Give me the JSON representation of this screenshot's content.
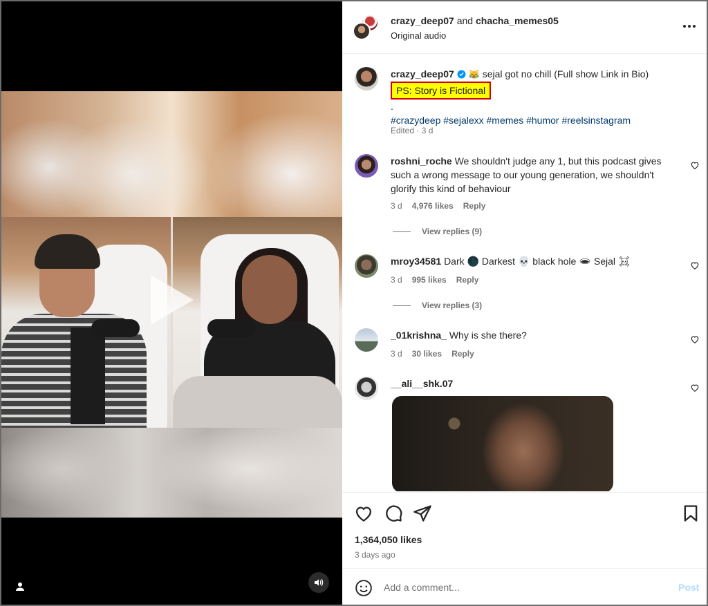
{
  "header": {
    "user1": "crazy_deep07",
    "joiner": "and",
    "user2": "chacha_memes05",
    "audio": "Original audio"
  },
  "caption": {
    "username": "crazy_deep07",
    "text": "sejal got no chill (Full show Link in Bio)",
    "highlighted": "PS: Story is Fictional",
    "dot": ".",
    "hashtags": "#crazydeep #sejalexx #memes #humor #reelsinstagram",
    "edited": "Edited · 3 d"
  },
  "comments": [
    {
      "username": "roshni_roche",
      "text": "We shouldn't judge any 1, but this podcast gives such a wrong message to our young generation, we shouldn't glorify this kind of behaviour",
      "age": "3 d",
      "likes": "4,976 likes",
      "reply": "Reply",
      "view_replies": "View replies (9)"
    },
    {
      "username": "mroy34581",
      "text": "Dark 🌑 Darkest 💀 black hole 🕳 Sejal ☠",
      "age": "3 d",
      "likes": "995 likes",
      "reply": "Reply",
      "view_replies": "View replies (3)"
    },
    {
      "username": "_01krishna_",
      "text": "Why is she there?",
      "age": "3 d",
      "likes": "30 likes",
      "reply": "Reply"
    },
    {
      "username": "__ali__shk.07"
    }
  ],
  "engagement": {
    "likes": "1,364,050 likes",
    "posted": "3 days ago"
  },
  "composer": {
    "placeholder": "Add a comment...",
    "post_label": "Post"
  },
  "colors": {
    "verified": "#0095f6",
    "highlight_bg": "#ffff00",
    "highlight_border": "#d40000",
    "hashtag": "#00376b",
    "post_disabled": "#b3dbff"
  },
  "icons": [
    "heart-icon",
    "comment-icon",
    "share-icon",
    "bookmark-icon",
    "more-icon",
    "emoji-icon",
    "volume-icon",
    "user-tag-icon",
    "play-icon",
    "verified-icon"
  ]
}
